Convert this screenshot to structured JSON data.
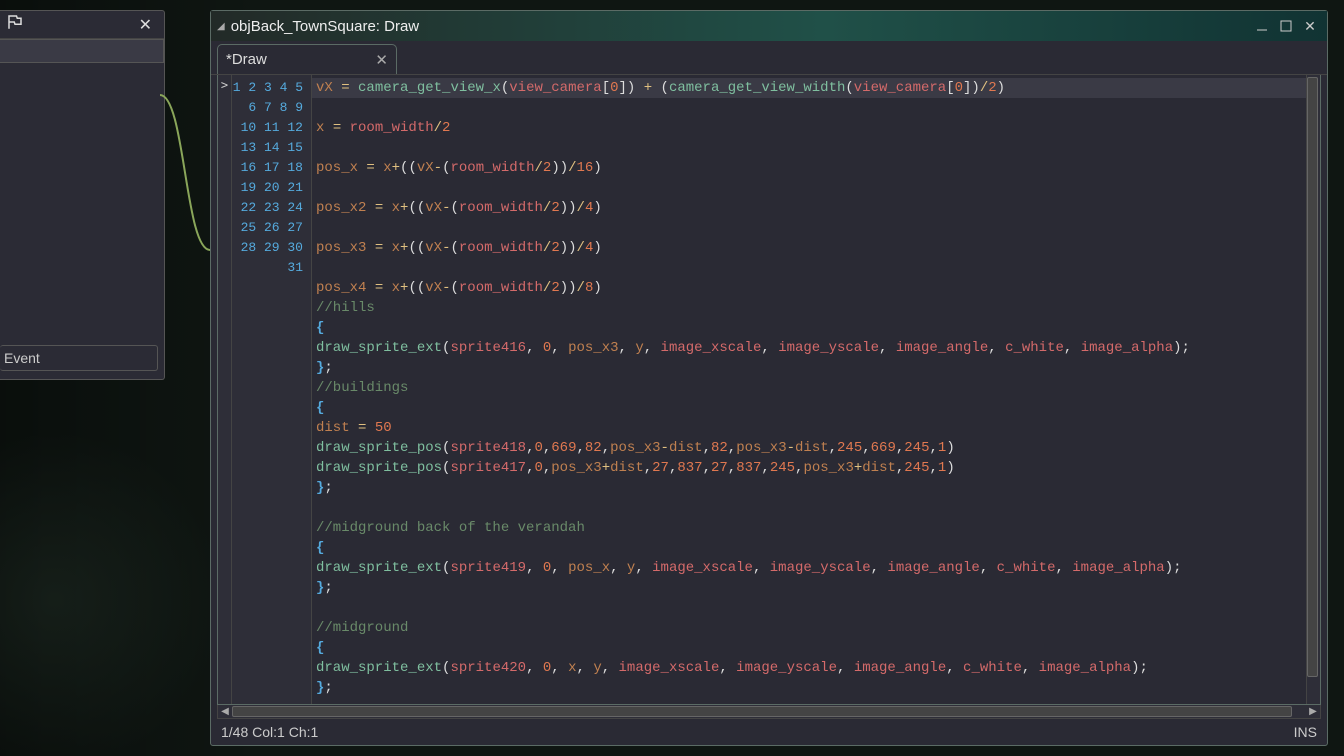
{
  "leftPanel": {
    "eventLabel": "Event"
  },
  "window": {
    "title": "objBack_TownSquare: Draw",
    "tabLabel": "*Draw"
  },
  "status": {
    "pos": "1/48 Col:1 Ch:1",
    "mode": "INS"
  },
  "gutterMarker": ">",
  "code": {
    "lineCount": 31,
    "lines": [
      [
        {
          "t": "var",
          "v": "vX"
        },
        {
          "t": "pun",
          "v": " "
        },
        {
          "t": "op",
          "v": "="
        },
        {
          "t": "pun",
          "v": " "
        },
        {
          "t": "fn",
          "v": "camera_get_view_x"
        },
        {
          "t": "pun",
          "v": "("
        },
        {
          "t": "id",
          "v": "view_camera"
        },
        {
          "t": "pun",
          "v": "["
        },
        {
          "t": "num",
          "v": "0"
        },
        {
          "t": "pun",
          "v": "]) "
        },
        {
          "t": "op",
          "v": "+"
        },
        {
          "t": "pun",
          "v": " ("
        },
        {
          "t": "fn",
          "v": "camera_get_view_width"
        },
        {
          "t": "pun",
          "v": "("
        },
        {
          "t": "id",
          "v": "view_camera"
        },
        {
          "t": "pun",
          "v": "["
        },
        {
          "t": "num",
          "v": "0"
        },
        {
          "t": "pun",
          "v": "])"
        },
        {
          "t": "op",
          "v": "/"
        },
        {
          "t": "num",
          "v": "2"
        },
        {
          "t": "pun",
          "v": ")"
        }
      ],
      [],
      [
        {
          "t": "var",
          "v": "x"
        },
        {
          "t": "pun",
          "v": " "
        },
        {
          "t": "op",
          "v": "="
        },
        {
          "t": "pun",
          "v": " "
        },
        {
          "t": "id",
          "v": "room_width"
        },
        {
          "t": "op",
          "v": "/"
        },
        {
          "t": "num",
          "v": "2"
        }
      ],
      [],
      [
        {
          "t": "var",
          "v": "pos_x"
        },
        {
          "t": "pun",
          "v": " "
        },
        {
          "t": "op",
          "v": "="
        },
        {
          "t": "pun",
          "v": " "
        },
        {
          "t": "var",
          "v": "x"
        },
        {
          "t": "op",
          "v": "+"
        },
        {
          "t": "pun",
          "v": "(("
        },
        {
          "t": "var",
          "v": "vX"
        },
        {
          "t": "op",
          "v": "-"
        },
        {
          "t": "pun",
          "v": "("
        },
        {
          "t": "id",
          "v": "room_width"
        },
        {
          "t": "op",
          "v": "/"
        },
        {
          "t": "num",
          "v": "2"
        },
        {
          "t": "pun",
          "v": "))"
        },
        {
          "t": "op",
          "v": "/"
        },
        {
          "t": "num",
          "v": "16"
        },
        {
          "t": "pun",
          "v": ")"
        }
      ],
      [],
      [
        {
          "t": "var",
          "v": "pos_x2"
        },
        {
          "t": "pun",
          "v": " "
        },
        {
          "t": "op",
          "v": "="
        },
        {
          "t": "pun",
          "v": " "
        },
        {
          "t": "var",
          "v": "x"
        },
        {
          "t": "op",
          "v": "+"
        },
        {
          "t": "pun",
          "v": "(("
        },
        {
          "t": "var",
          "v": "vX"
        },
        {
          "t": "op",
          "v": "-"
        },
        {
          "t": "pun",
          "v": "("
        },
        {
          "t": "id",
          "v": "room_width"
        },
        {
          "t": "op",
          "v": "/"
        },
        {
          "t": "num",
          "v": "2"
        },
        {
          "t": "pun",
          "v": "))"
        },
        {
          "t": "op",
          "v": "/"
        },
        {
          "t": "num",
          "v": "4"
        },
        {
          "t": "pun",
          "v": ")"
        }
      ],
      [],
      [
        {
          "t": "var",
          "v": "pos_x3"
        },
        {
          "t": "pun",
          "v": " "
        },
        {
          "t": "op",
          "v": "="
        },
        {
          "t": "pun",
          "v": " "
        },
        {
          "t": "var",
          "v": "x"
        },
        {
          "t": "op",
          "v": "+"
        },
        {
          "t": "pun",
          "v": "(("
        },
        {
          "t": "var",
          "v": "vX"
        },
        {
          "t": "op",
          "v": "-"
        },
        {
          "t": "pun",
          "v": "("
        },
        {
          "t": "id",
          "v": "room_width"
        },
        {
          "t": "op",
          "v": "/"
        },
        {
          "t": "num",
          "v": "2"
        },
        {
          "t": "pun",
          "v": "))"
        },
        {
          "t": "op",
          "v": "/"
        },
        {
          "t": "num",
          "v": "4"
        },
        {
          "t": "pun",
          "v": ")"
        }
      ],
      [],
      [
        {
          "t": "var",
          "v": "pos_x4"
        },
        {
          "t": "pun",
          "v": " "
        },
        {
          "t": "op",
          "v": "="
        },
        {
          "t": "pun",
          "v": " "
        },
        {
          "t": "var",
          "v": "x"
        },
        {
          "t": "op",
          "v": "+"
        },
        {
          "t": "pun",
          "v": "(("
        },
        {
          "t": "var",
          "v": "vX"
        },
        {
          "t": "op",
          "v": "-"
        },
        {
          "t": "pun",
          "v": "("
        },
        {
          "t": "id",
          "v": "room_width"
        },
        {
          "t": "op",
          "v": "/"
        },
        {
          "t": "num",
          "v": "2"
        },
        {
          "t": "pun",
          "v": "))"
        },
        {
          "t": "op",
          "v": "/"
        },
        {
          "t": "num",
          "v": "8"
        },
        {
          "t": "pun",
          "v": ")"
        }
      ],
      [
        {
          "t": "cmt",
          "v": "//hills"
        }
      ],
      [
        {
          "t": "brk",
          "v": "{"
        }
      ],
      [
        {
          "t": "fn",
          "v": "draw_sprite_ext"
        },
        {
          "t": "pun",
          "v": "("
        },
        {
          "t": "id",
          "v": "sprite416"
        },
        {
          "t": "pun",
          "v": ", "
        },
        {
          "t": "num",
          "v": "0"
        },
        {
          "t": "pun",
          "v": ", "
        },
        {
          "t": "var",
          "v": "pos_x3"
        },
        {
          "t": "pun",
          "v": ", "
        },
        {
          "t": "var",
          "v": "y"
        },
        {
          "t": "pun",
          "v": ", "
        },
        {
          "t": "id",
          "v": "image_xscale"
        },
        {
          "t": "pun",
          "v": ", "
        },
        {
          "t": "id",
          "v": "image_yscale"
        },
        {
          "t": "pun",
          "v": ", "
        },
        {
          "t": "id",
          "v": "image_angle"
        },
        {
          "t": "pun",
          "v": ", "
        },
        {
          "t": "id",
          "v": "c_white"
        },
        {
          "t": "pun",
          "v": ", "
        },
        {
          "t": "id",
          "v": "image_alpha"
        },
        {
          "t": "pun",
          "v": ");"
        }
      ],
      [
        {
          "t": "brk",
          "v": "}"
        },
        {
          "t": "pun",
          "v": ";"
        }
      ],
      [
        {
          "t": "cmt",
          "v": "//buildings"
        }
      ],
      [
        {
          "t": "brk",
          "v": "{"
        }
      ],
      [
        {
          "t": "var",
          "v": "dist"
        },
        {
          "t": "pun",
          "v": " "
        },
        {
          "t": "op",
          "v": "="
        },
        {
          "t": "pun",
          "v": " "
        },
        {
          "t": "num",
          "v": "50"
        }
      ],
      [
        {
          "t": "fn",
          "v": "draw_sprite_pos"
        },
        {
          "t": "pun",
          "v": "("
        },
        {
          "t": "id",
          "v": "sprite418"
        },
        {
          "t": "pun",
          "v": ","
        },
        {
          "t": "num",
          "v": "0"
        },
        {
          "t": "pun",
          "v": ","
        },
        {
          "t": "num",
          "v": "669"
        },
        {
          "t": "pun",
          "v": ","
        },
        {
          "t": "num",
          "v": "82"
        },
        {
          "t": "pun",
          "v": ","
        },
        {
          "t": "var",
          "v": "pos_x3"
        },
        {
          "t": "op",
          "v": "-"
        },
        {
          "t": "var",
          "v": "dist"
        },
        {
          "t": "pun",
          "v": ","
        },
        {
          "t": "num",
          "v": "82"
        },
        {
          "t": "pun",
          "v": ","
        },
        {
          "t": "var",
          "v": "pos_x3"
        },
        {
          "t": "op",
          "v": "-"
        },
        {
          "t": "var",
          "v": "dist"
        },
        {
          "t": "pun",
          "v": ","
        },
        {
          "t": "num",
          "v": "245"
        },
        {
          "t": "pun",
          "v": ","
        },
        {
          "t": "num",
          "v": "669"
        },
        {
          "t": "pun",
          "v": ","
        },
        {
          "t": "num",
          "v": "245"
        },
        {
          "t": "pun",
          "v": ","
        },
        {
          "t": "num",
          "v": "1"
        },
        {
          "t": "pun",
          "v": ")"
        }
      ],
      [
        {
          "t": "fn",
          "v": "draw_sprite_pos"
        },
        {
          "t": "pun",
          "v": "("
        },
        {
          "t": "id",
          "v": "sprite417"
        },
        {
          "t": "pun",
          "v": ","
        },
        {
          "t": "num",
          "v": "0"
        },
        {
          "t": "pun",
          "v": ","
        },
        {
          "t": "var",
          "v": "pos_x3"
        },
        {
          "t": "op",
          "v": "+"
        },
        {
          "t": "var",
          "v": "dist"
        },
        {
          "t": "pun",
          "v": ","
        },
        {
          "t": "num",
          "v": "27"
        },
        {
          "t": "pun",
          "v": ","
        },
        {
          "t": "num",
          "v": "837"
        },
        {
          "t": "pun",
          "v": ","
        },
        {
          "t": "num",
          "v": "27"
        },
        {
          "t": "pun",
          "v": ","
        },
        {
          "t": "num",
          "v": "837"
        },
        {
          "t": "pun",
          "v": ","
        },
        {
          "t": "num",
          "v": "245"
        },
        {
          "t": "pun",
          "v": ","
        },
        {
          "t": "var",
          "v": "pos_x3"
        },
        {
          "t": "op",
          "v": "+"
        },
        {
          "t": "var",
          "v": "dist"
        },
        {
          "t": "pun",
          "v": ","
        },
        {
          "t": "num",
          "v": "245"
        },
        {
          "t": "pun",
          "v": ","
        },
        {
          "t": "num",
          "v": "1"
        },
        {
          "t": "pun",
          "v": ")"
        }
      ],
      [
        {
          "t": "brk",
          "v": "}"
        },
        {
          "t": "pun",
          "v": ";"
        }
      ],
      [],
      [
        {
          "t": "cmt",
          "v": "//midground back of the verandah"
        }
      ],
      [
        {
          "t": "brk",
          "v": "{"
        }
      ],
      [
        {
          "t": "fn",
          "v": "draw_sprite_ext"
        },
        {
          "t": "pun",
          "v": "("
        },
        {
          "t": "id",
          "v": "sprite419"
        },
        {
          "t": "pun",
          "v": ", "
        },
        {
          "t": "num",
          "v": "0"
        },
        {
          "t": "pun",
          "v": ", "
        },
        {
          "t": "var",
          "v": "pos_x"
        },
        {
          "t": "pun",
          "v": ", "
        },
        {
          "t": "var",
          "v": "y"
        },
        {
          "t": "pun",
          "v": ", "
        },
        {
          "t": "id",
          "v": "image_xscale"
        },
        {
          "t": "pun",
          "v": ", "
        },
        {
          "t": "id",
          "v": "image_yscale"
        },
        {
          "t": "pun",
          "v": ", "
        },
        {
          "t": "id",
          "v": "image_angle"
        },
        {
          "t": "pun",
          "v": ", "
        },
        {
          "t": "id",
          "v": "c_white"
        },
        {
          "t": "pun",
          "v": ", "
        },
        {
          "t": "id",
          "v": "image_alpha"
        },
        {
          "t": "pun",
          "v": ");"
        }
      ],
      [
        {
          "t": "brk",
          "v": "}"
        },
        {
          "t": "pun",
          "v": ";"
        }
      ],
      [],
      [
        {
          "t": "cmt",
          "v": "//midground"
        }
      ],
      [
        {
          "t": "brk",
          "v": "{"
        }
      ],
      [
        {
          "t": "fn",
          "v": "draw_sprite_ext"
        },
        {
          "t": "pun",
          "v": "("
        },
        {
          "t": "id",
          "v": "sprite420"
        },
        {
          "t": "pun",
          "v": ", "
        },
        {
          "t": "num",
          "v": "0"
        },
        {
          "t": "pun",
          "v": ", "
        },
        {
          "t": "var",
          "v": "x"
        },
        {
          "t": "pun",
          "v": ", "
        },
        {
          "t": "var",
          "v": "y"
        },
        {
          "t": "pun",
          "v": ", "
        },
        {
          "t": "id",
          "v": "image_xscale"
        },
        {
          "t": "pun",
          "v": ", "
        },
        {
          "t": "id",
          "v": "image_yscale"
        },
        {
          "t": "pun",
          "v": ", "
        },
        {
          "t": "id",
          "v": "image_angle"
        },
        {
          "t": "pun",
          "v": ", "
        },
        {
          "t": "id",
          "v": "c_white"
        },
        {
          "t": "pun",
          "v": ", "
        },
        {
          "t": "id",
          "v": "image_alpha"
        },
        {
          "t": "pun",
          "v": ");"
        }
      ],
      [
        {
          "t": "brk",
          "v": "}"
        },
        {
          "t": "pun",
          "v": ";"
        }
      ]
    ]
  }
}
